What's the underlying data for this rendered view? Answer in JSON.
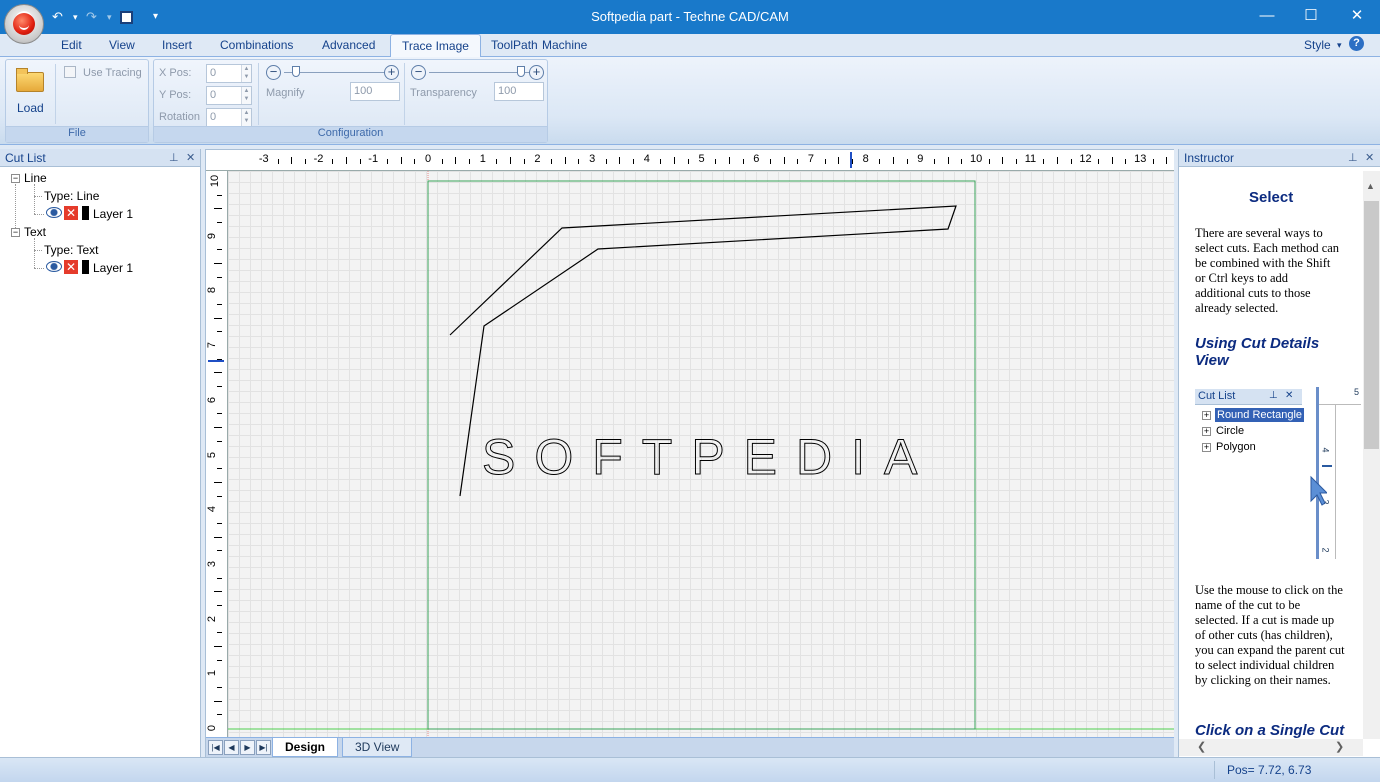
{
  "window": {
    "title": "Softpedia part - Techne CAD/CAM",
    "minimize": "—",
    "maximize": "☐",
    "close": "✕"
  },
  "qat": {
    "undo": "↶",
    "redo": "↷",
    "save": "▪",
    "dropdown": "▾"
  },
  "menu": {
    "tabs": [
      "Edit",
      "View",
      "Insert",
      "Combinations",
      "Advanced",
      "Trace Image",
      "ToolPath",
      "Machine"
    ],
    "active": "Trace Image",
    "style_label": "Style",
    "style_arrow": "▾",
    "help": "?"
  },
  "ribbon": {
    "file_group": {
      "load_label": "Load",
      "group_label": "File"
    },
    "config_group": {
      "use_tracing": "Use Tracing",
      "xpos_label": "X Pos:",
      "xpos_value": "0",
      "ypos_label": "Y Pos:",
      "ypos_value": "0",
      "rotation_label": "Rotation",
      "rotation_value": "0",
      "magnify_label": "Magnify",
      "magnify_value": "100",
      "transparency_label": "Transparency",
      "transparency_value": "100",
      "group_label": "Configuration",
      "minus": "−",
      "plus": "+"
    }
  },
  "cutlist": {
    "title": "Cut List",
    "pin": "⊥",
    "close": "✕",
    "items": [
      {
        "name": "Line",
        "type": "Type: Line",
        "layer": "Layer 1"
      },
      {
        "name": "Text",
        "type": "Type: Text",
        "layer": "Layer 1"
      }
    ],
    "collapse": "−"
  },
  "canvas": {
    "hruler_labels": [
      "-3",
      "-2",
      "-1",
      "0",
      "1",
      "2",
      "3",
      "4",
      "5",
      "6",
      "7",
      "8",
      "9",
      "10",
      "11",
      "12",
      "13"
    ],
    "vruler_labels": [
      "10",
      "9",
      "8",
      "7",
      "6",
      "5",
      "4",
      "3",
      "2",
      "1",
      "0"
    ],
    "text_object": "SOFTPEDIA",
    "tabs": [
      "Design",
      "3D View"
    ],
    "active_tab": "Design",
    "nav": [
      "|◀",
      "◀",
      "▶",
      "▶|"
    ]
  },
  "instructor": {
    "title": "Instructor",
    "pin": "⊥",
    "close": "✕",
    "heading": "Select",
    "intro": "There are several ways to select cuts. Each method can be combined with the Shift or Ctrl keys to add additional cuts to those already selected.",
    "section1": "Using Cut Details View",
    "mini_cutlist": {
      "title": "Cut List",
      "items": [
        "Round Rectangle",
        "Circle",
        "Polygon"
      ],
      "ruler_labels": [
        "4",
        "3",
        "2"
      ],
      "plus": "+",
      "pin": "⊥",
      "close": "✕",
      "top_label": "5"
    },
    "body2": "Use the mouse to click on the name of the cut to be selected.  If a cut is made up of other cuts (has children), you can expand the parent cut to select individual children by clicking on their names.",
    "section2": "Click on a Single Cut",
    "scroll_up": "▲",
    "scroll_left": "❮",
    "scroll_right": "❯"
  },
  "status": {
    "pos": "Pos= 7.72, 6.73"
  }
}
